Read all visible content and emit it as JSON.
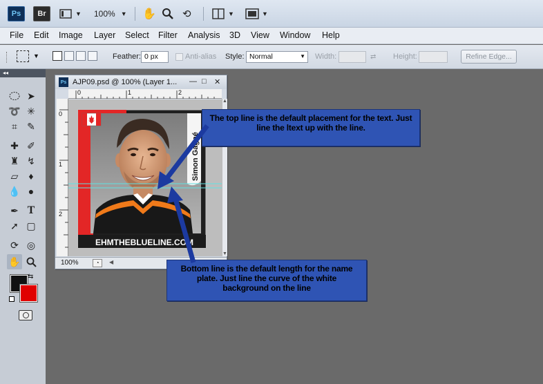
{
  "appbar": {
    "ps_logo": "Ps",
    "br_logo": "Br",
    "zoom": "100%",
    "icons": [
      "launch-bridge-icon",
      "screen-mode-icon",
      "hand-tool-icon",
      "zoom-tool-icon",
      "rotate-view-icon",
      "arrange-documents-icon",
      "screen-mode-switch-icon"
    ]
  },
  "menu": [
    "File",
    "Edit",
    "Image",
    "Layer",
    "Select",
    "Filter",
    "Analysis",
    "3D",
    "View",
    "Window",
    "Help"
  ],
  "options": {
    "feather_label": "Feather:",
    "feather_value": "0 px",
    "antialias_label": "Anti-alias",
    "style_label": "Style:",
    "style_value": "Normal",
    "width_label": "Width:",
    "height_label": "Height:",
    "refine_label": "Refine Edge..."
  },
  "document": {
    "title": "AJP09.psd @ 100% (Layer 1...",
    "zoom": "100%",
    "ruler_top": [
      "0",
      "1",
      "2"
    ],
    "ruler_left": [
      "0",
      "1",
      "2"
    ],
    "card": {
      "player_name": "Simon Gagné",
      "site_text": "EHMTHEBLUELINE.COM"
    }
  },
  "callouts": {
    "top": "The top line is the default placement for the text. Just line the ltext up with the line.",
    "bottom": "Bottom line is the default length for the name plate. Just line the curve of the white background on the line"
  },
  "colors": {
    "foreground": "#111111",
    "background": "#e00000",
    "callout_fill": "#2f54b4",
    "guide": "#5fe3e3"
  }
}
